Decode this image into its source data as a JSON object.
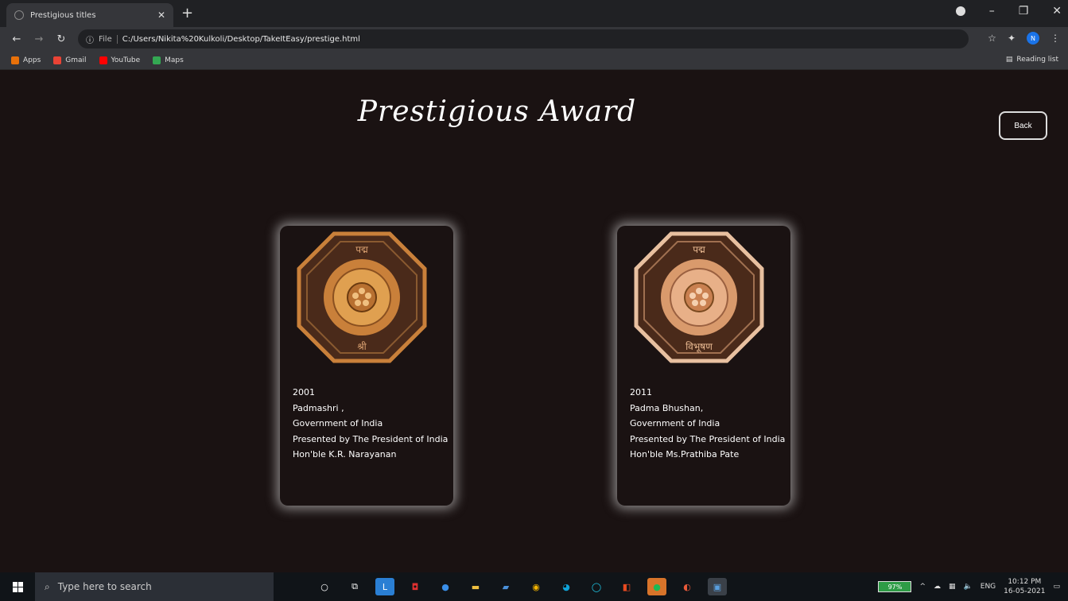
{
  "browser": {
    "tab_title": "Prestigious titles",
    "url_scheme": "File",
    "url": "C:/Users/Nikita%20Kulkoli/Desktop/TakeItEasy/prestige.html",
    "bookmarks": [
      {
        "label": "Apps",
        "color": "#e8710a"
      },
      {
        "label": "Gmail",
        "color": "#ea4335"
      },
      {
        "label": "YouTube",
        "color": "#ff0000"
      },
      {
        "label": "Maps",
        "color": "#34a853"
      }
    ],
    "reading_list": "Reading list",
    "avatar_letter": "N"
  },
  "page": {
    "title": "Prestigious Award",
    "back_label": "Back",
    "cards": [
      {
        "medal_top": "पद्म",
        "medal_bottom": "श्री",
        "year": "2001",
        "award": "Padmashri ,",
        "org": "Government of India",
        "presented": "Presented by The President of India",
        "by": "Hon'ble K.R. Narayanan",
        "medal_color": "#c9803a"
      },
      {
        "medal_top": "पद्म",
        "medal_bottom": "विभूषण",
        "year": "2011",
        "award": "Padma Bhushan,",
        "org": "Government of India",
        "presented": "Presented by The President of India",
        "by": "Hon'ble Ms.Prathiba Pate",
        "medal_color": "#d99a6c"
      }
    ]
  },
  "taskbar": {
    "search_placeholder": "Type here to search",
    "battery": "97%",
    "language": "ENG",
    "time": "10:12 PM",
    "date": "16-05-2021"
  }
}
